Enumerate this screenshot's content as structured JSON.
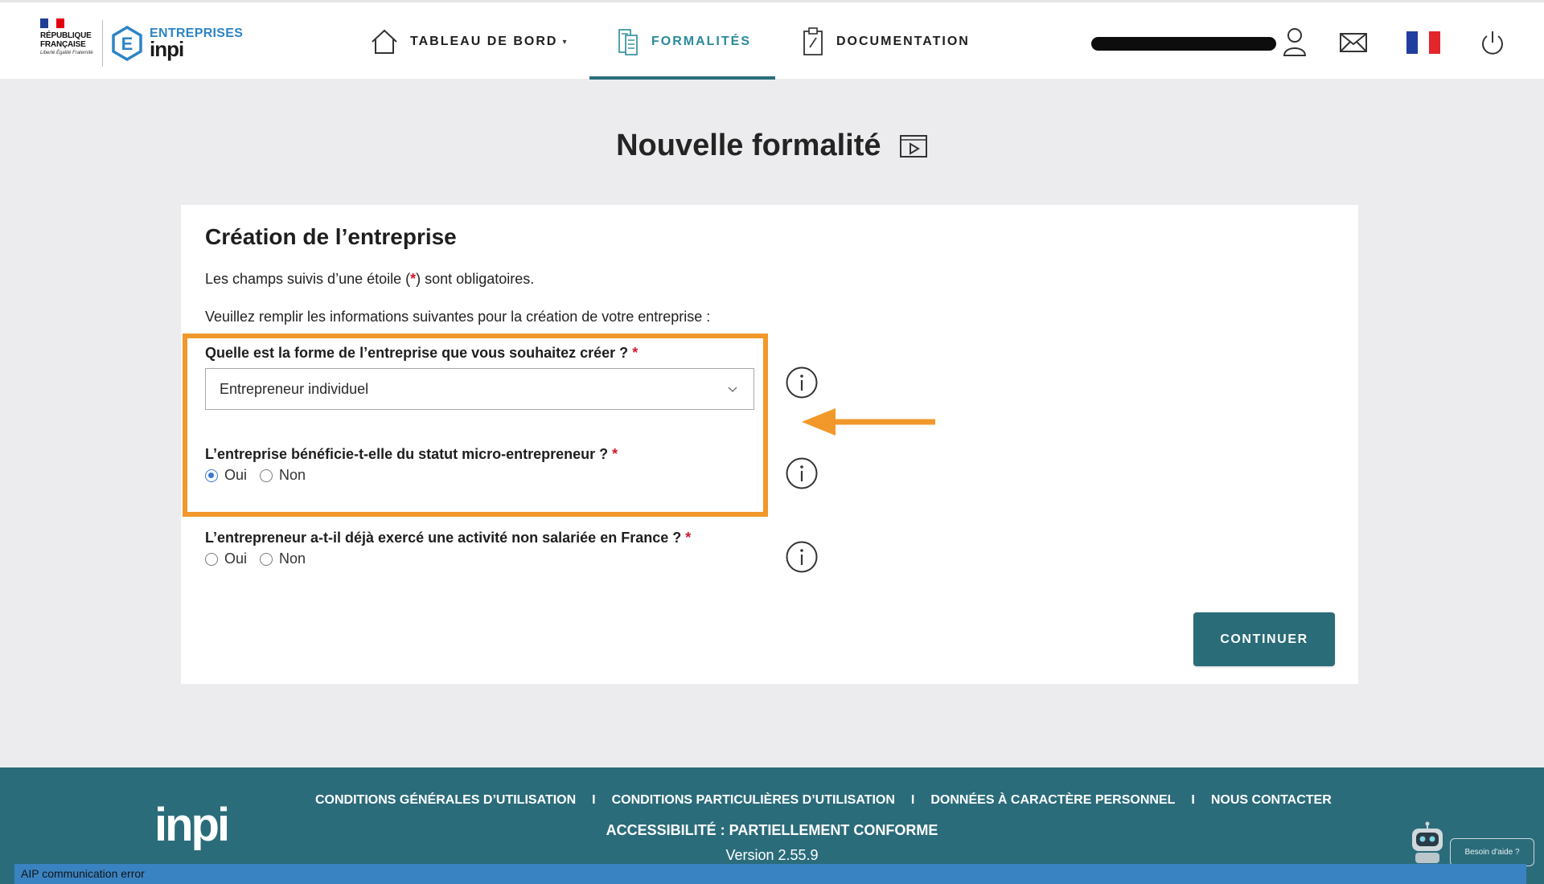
{
  "header": {
    "rf_logo": {
      "lines": [
        "RÉPUBLIQUE",
        "FRANÇAISE"
      ],
      "motto": "Liberté Égalité Fraternité"
    },
    "brand": {
      "top": "ENTREPRISES",
      "bottom": "inpi"
    },
    "nav": [
      {
        "label": "TABLEAU DE BORD",
        "icon": "home-icon",
        "has_caret": true
      },
      {
        "label": "FORMALITÉS",
        "icon": "document-list-icon",
        "active": true
      },
      {
        "label": "DOCUMENTATION",
        "icon": "clipboard-icon"
      }
    ],
    "icons": [
      "user-icon",
      "mail-icon",
      "french-flag-icon",
      "power-icon"
    ]
  },
  "page": {
    "title": "Nouvelle formalité",
    "title_icon": "video-play-icon"
  },
  "form": {
    "section_title": "Création de l’entreprise",
    "required_note_before": "Les champs suivis d’une étoile (",
    "required_star": "*",
    "required_note_after": ") sont obligatoires.",
    "intro": "Veuillez remplir les informations suivantes pour la création de votre entreprise :",
    "q1": {
      "label": "Quelle est la forme de l’entreprise que vous souhaitez créer ?",
      "star": "*",
      "selected": "Entrepreneur individuel"
    },
    "q2": {
      "label": "L’entreprise bénéficie-t-elle du statut micro-entrepreneur ?",
      "star": "*",
      "options": [
        "Oui",
        "Non"
      ],
      "selected": "Oui"
    },
    "q3": {
      "label": "L’entrepreneur a-t-il déjà exercé une activité non salariée en France ?",
      "star": "*",
      "options": [
        "Oui",
        "Non"
      ],
      "selected": ""
    },
    "continue_label": "CONTINUER"
  },
  "colors": {
    "accent": "#2a6c78",
    "highlight": "#f2982a",
    "required": "#d2182c"
  },
  "footer": {
    "logo": "inpi",
    "links": [
      "CONDITIONS GÉNÉRALES D’UTILISATION",
      "CONDITIONS PARTICULIÈRES D’UTILISATION",
      "DONNÉES À CARACTÈRE PERSONNEL",
      "NOUS CONTACTER"
    ],
    "separator": "I",
    "accessibility": "ACCESSIBILITÉ : PARTIELLEMENT CONFORME",
    "version": "Version 2.55.9",
    "help_label": "Besoin d'aide ?",
    "status_message": "AIP communication error"
  }
}
